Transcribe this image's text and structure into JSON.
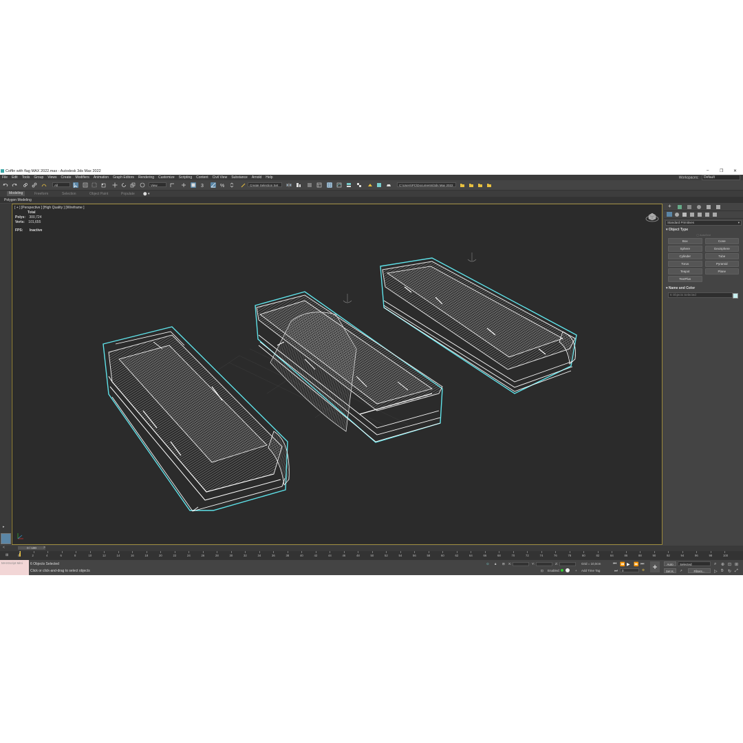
{
  "window": {
    "title": "Coffin with flag MAX 2022.max - Autodesk 3ds Max 2022",
    "controls": [
      "minimize",
      "restore",
      "close"
    ]
  },
  "menu": [
    "File",
    "Edit",
    "Tools",
    "Group",
    "Views",
    "Create",
    "Modifiers",
    "Animation",
    "Graph Editors",
    "Rendering",
    "Customize",
    "Scripting",
    "Content",
    "Civil View",
    "Substance",
    "Arnold",
    "Help"
  ],
  "workspace": {
    "label": "Workspaces:",
    "value": "Default"
  },
  "toolbar": {
    "selection_filter": "All",
    "ref_coord": "View",
    "selection_set": "Create Selection Set",
    "project_path": "C:\\Users\\PC\\Documents\\3ds Max 2022"
  },
  "ribbon": {
    "tabs": [
      "Modeling",
      "Freeform",
      "Selection",
      "Object Paint",
      "Populate"
    ],
    "active_tab": "Modeling",
    "sub": "Polygon Modeling"
  },
  "viewport": {
    "label": "[ + ] [Perspective ] [High Quality ] [Wireframe ]",
    "stats": {
      "total_label": "Total",
      "polys_label": "Polys:",
      "polys": "300,724",
      "verts_label": "Verts:",
      "verts": "101,655",
      "fps_label": "FPS:",
      "fps": "Inactive"
    },
    "wire_color": "#5fe3ea"
  },
  "command_panel": {
    "dropdown": "Standard Primitives",
    "object_type_title": "Object Type",
    "autogrid": "AutoGrid",
    "buttons": [
      "Box",
      "Cone",
      "Sphere",
      "GeoSphere",
      "Cylinder",
      "Tube",
      "Torus",
      "Pyramid",
      "Teapot",
      "Plane",
      "TextPlus"
    ],
    "name_color_title": "Name and Color",
    "name_field": "6 Objects Selected"
  },
  "timeline": {
    "frame_display": "0 / 100",
    "ticks": [
      "0",
      "2",
      "4",
      "6",
      "8",
      "10",
      "12",
      "14",
      "16",
      "18",
      "20",
      "22",
      "24",
      "26",
      "28",
      "30",
      "32",
      "34",
      "36",
      "38",
      "40",
      "42",
      "44",
      "46",
      "48",
      "50",
      "52",
      "54",
      "56",
      "58",
      "60",
      "62",
      "64",
      "66",
      "68",
      "70",
      "72",
      "74",
      "76",
      "78",
      "80",
      "82",
      "84",
      "86",
      "88",
      "90",
      "92",
      "94",
      "96",
      "98",
      "100"
    ]
  },
  "status": {
    "maxscript": "MAXScript Mini",
    "selected": "6 Objects Selected",
    "prompt": "Click or click-and-drag to select objects",
    "x_label": "X:",
    "y_label": "Y:",
    "z_label": "Z:",
    "grid": "Grid = 10,0cm",
    "enabled": "Enabled:",
    "add_time_tag": "Add Time Tag",
    "auto": "Auto",
    "set_k": "Set K.",
    "selected_dd": "Selected",
    "filters": "Filters...",
    "frame_field": "0"
  }
}
